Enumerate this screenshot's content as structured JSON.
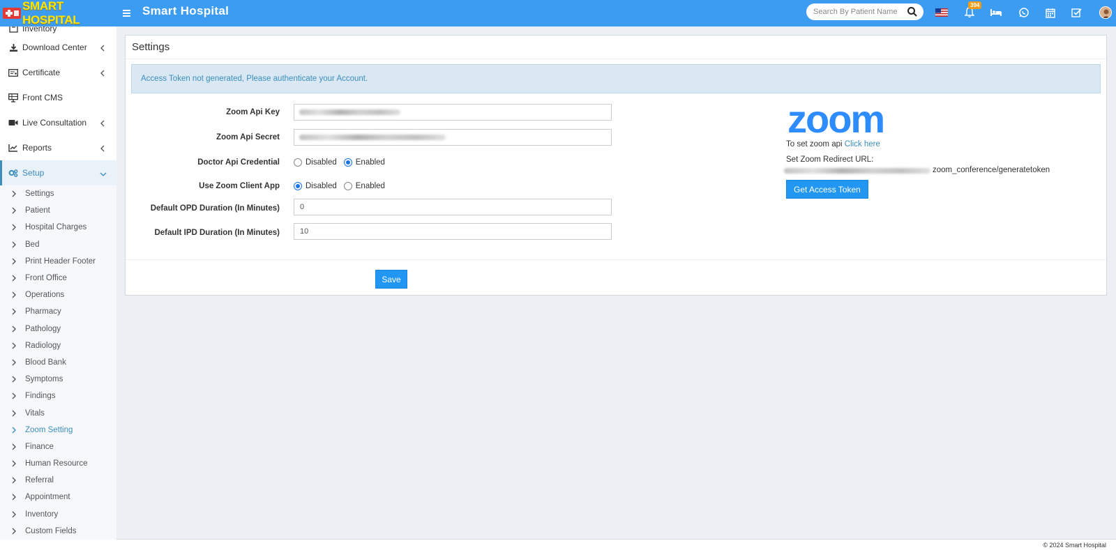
{
  "header": {
    "logo_text": "SMART HOSPITAL",
    "app_title": "Smart Hospital",
    "search_placeholder": "Search By Patient Name",
    "notification_count": "394",
    "accent_color": "#3c9cf2"
  },
  "sidebar": {
    "top_partial": "Inventory",
    "items": [
      {
        "label": "Download Center",
        "icon": "download-icon"
      },
      {
        "label": "Certificate",
        "icon": "certificate-icon"
      },
      {
        "label": "Front CMS",
        "icon": "cms-icon"
      },
      {
        "label": "Live Consultation",
        "icon": "video-icon"
      },
      {
        "label": "Reports",
        "icon": "chart-icon"
      },
      {
        "label": "Setup",
        "icon": "gears-icon"
      }
    ],
    "setup_items": [
      "Settings",
      "Patient",
      "Hospital Charges",
      "Bed",
      "Print Header Footer",
      "Front Office",
      "Operations",
      "Pharmacy",
      "Pathology",
      "Radiology",
      "Blood Bank",
      "Symptoms",
      "Findings",
      "Vitals",
      "Zoom Setting",
      "Finance",
      "Human Resource",
      "Referral",
      "Appointment",
      "Inventory",
      "Custom Fields"
    ]
  },
  "main": {
    "title": "Settings",
    "alert": "Access Token not generated, Please authenticate your Account.",
    "fields": {
      "api_key_label": "Zoom Api Key",
      "api_secret_label": "Zoom Api Secret",
      "doctor_cred_label": "Doctor Api Credential",
      "client_app_label": "Use Zoom Client App",
      "opd_label": "Default OPD Duration (In Minutes)",
      "opd_value": "0",
      "ipd_label": "Default IPD Duration (In Minutes)",
      "ipd_value": "10"
    },
    "radio_disabled": "Disabled",
    "radio_enabled": "Enabled",
    "doctor_cred_selected": "Enabled",
    "client_app_selected": "Disabled",
    "save_label": "Save"
  },
  "zoom": {
    "logo_text": "zoom",
    "set_api_text": "To set zoom api",
    "click_here": "Click here",
    "redirect_label": "Set Zoom Redirect URL:",
    "redirect_suffix": "zoom_conference/generatetoken",
    "token_button": "Get Access Token"
  },
  "footer": {
    "copyright": "© 2024 Smart Hospital"
  }
}
